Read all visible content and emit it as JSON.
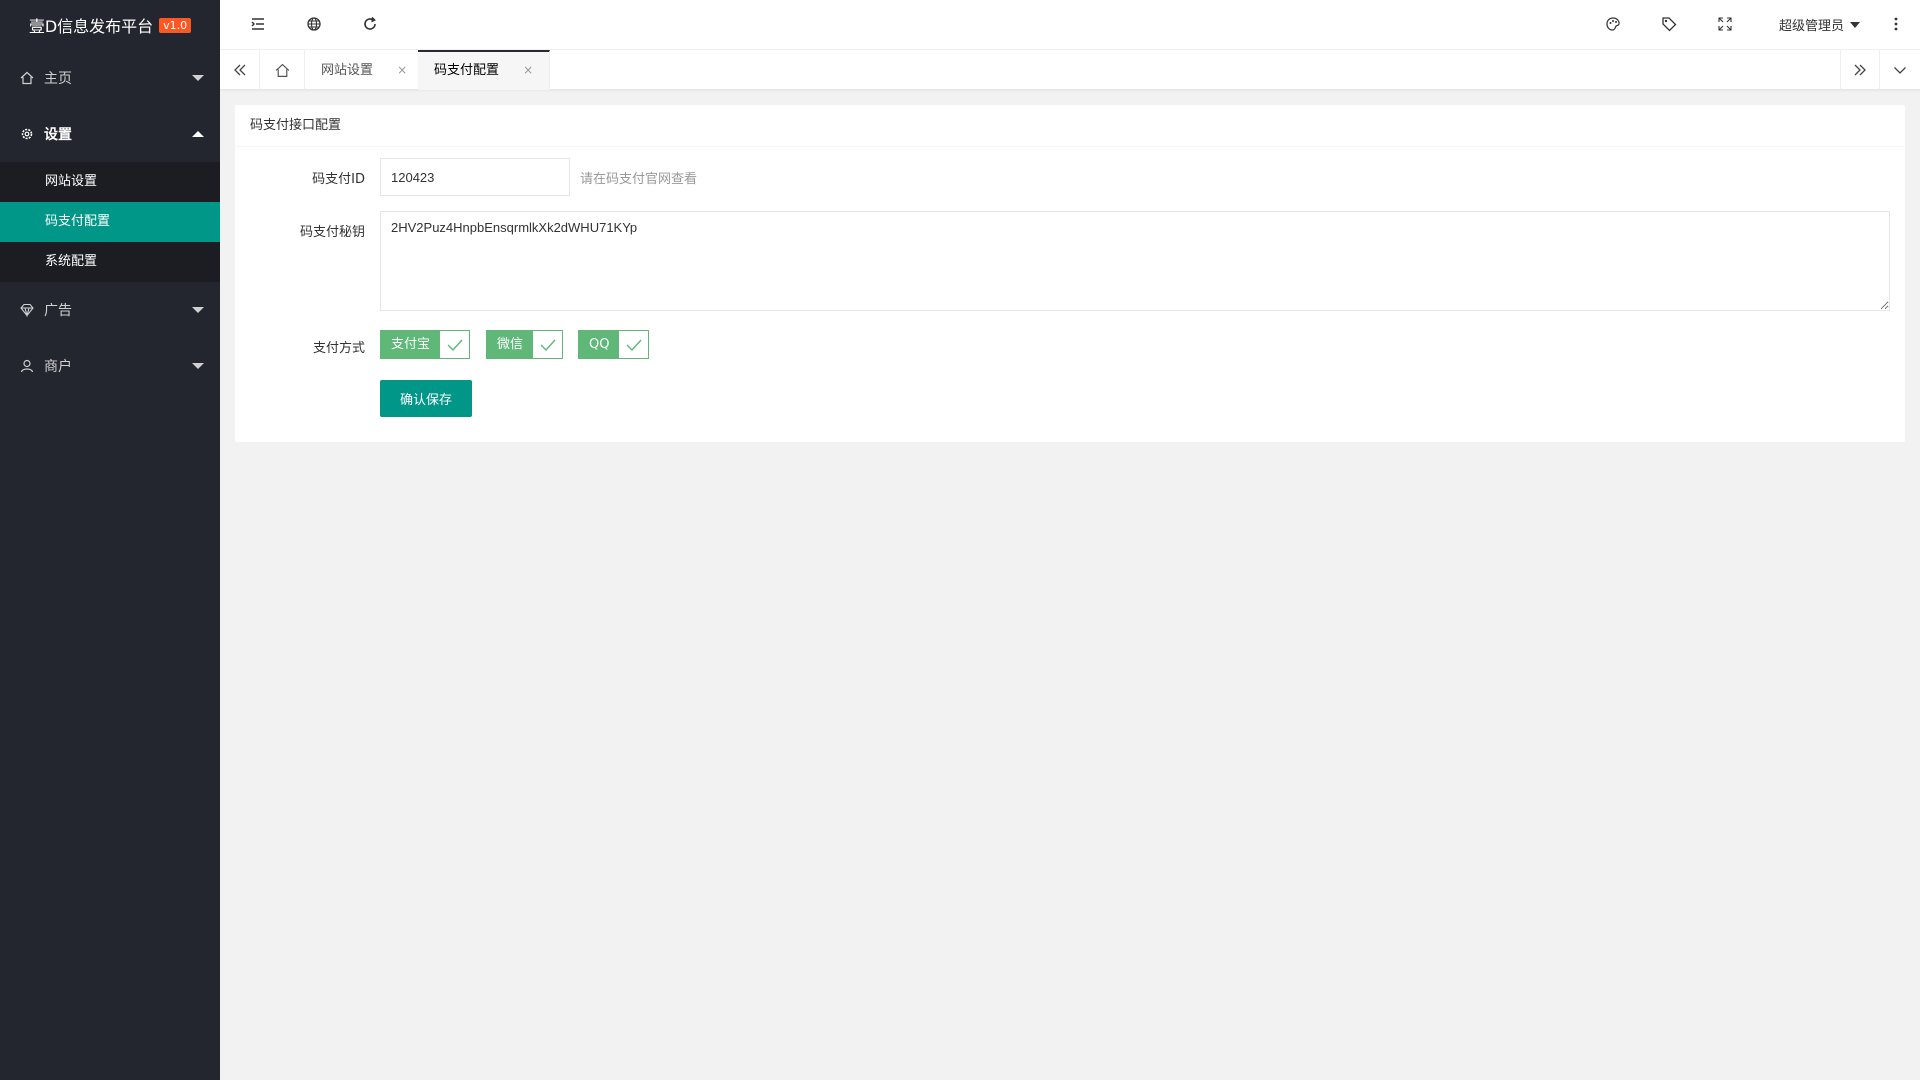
{
  "brand": {
    "title": "壹D信息发布平台",
    "version": "v1.0"
  },
  "sidebar": {
    "items": [
      {
        "label": "主页",
        "icon": "home-icon"
      },
      {
        "label": "设置",
        "icon": "gear-icon",
        "open": true,
        "children": [
          {
            "label": "网站设置"
          },
          {
            "label": "码支付配置",
            "active": true
          },
          {
            "label": "系统配置"
          }
        ]
      },
      {
        "label": "广告",
        "icon": "diamond-icon"
      },
      {
        "label": "商户",
        "icon": "user-icon"
      }
    ]
  },
  "header": {
    "user_name": "超级管理员"
  },
  "tabs": [
    {
      "label": "网站设置",
      "close": "×"
    },
    {
      "label": "码支付配置",
      "close": "×",
      "active": true
    }
  ],
  "form": {
    "card_title": "码支付接口配置",
    "id_label": "码支付ID",
    "id_value": "120423",
    "id_hint": "请在码支付官网查看",
    "secret_label": "码支付秘钥",
    "secret_value": "2HV2Puz4HnpbEnsqrmlkXk2dWHU71KYp",
    "pay_label": "支付方式",
    "pay_methods": [
      "支付宝",
      "微信",
      "QQ"
    ],
    "save_label": "确认保存"
  },
  "colors": {
    "sidebar": "#23262e",
    "accent": "#009688",
    "check": "#5fb878",
    "badge": "#ff5722"
  }
}
